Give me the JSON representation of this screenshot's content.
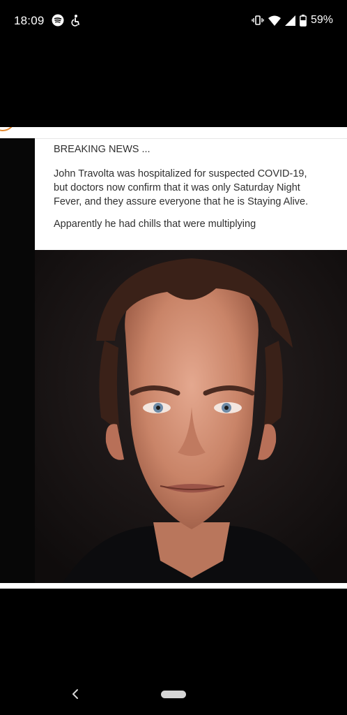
{
  "status_bar": {
    "time": "18:09",
    "battery": "59%",
    "icons": [
      "spotify-icon",
      "accessibility-icon",
      "vibrate-icon",
      "wifi-icon",
      "signal-icon",
      "battery-icon"
    ]
  },
  "post": {
    "headline": "BREAKING NEWS ...",
    "body": "John Travolta was hospitalized for suspected COVID-19,\nbut doctors now confirm that it was only Saturday Night\nFever, and they assure everyone that he is Staying Alive.",
    "closing": "Apparently he had chills that were multiplying"
  },
  "nav_bar": {
    "icons": [
      "back-chevron-icon",
      "home-pill"
    ]
  },
  "colors": {
    "background": "#000000",
    "card": "#ffffff",
    "text": "#303030"
  }
}
